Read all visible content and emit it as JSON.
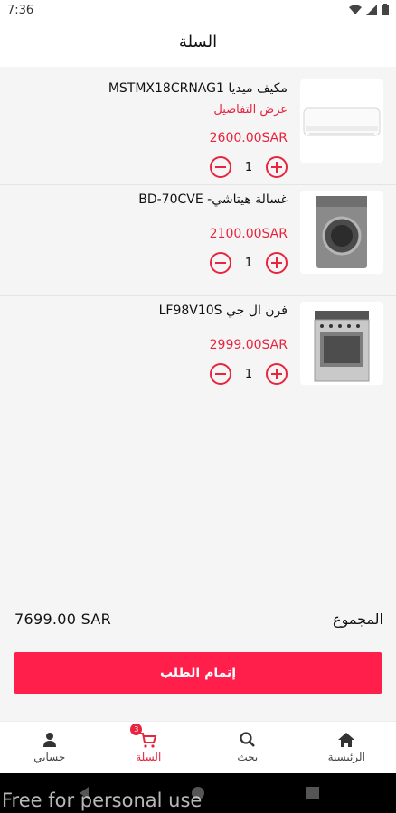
{
  "status": {
    "time": "7:36",
    "icons": [
      "wifi-icon",
      "cellular-signal-icon",
      "battery-icon"
    ]
  },
  "header": {
    "title": "السلة"
  },
  "cart": {
    "items": [
      {
        "name": "مكيف ميديا MSTMX18CRNAG1",
        "details_link": "عرض التفاصيل",
        "price": "2600.00SAR",
        "quantity": "1",
        "image": "air-conditioner-image"
      },
      {
        "name": "غسالة هيتاشي- BD-70CVE",
        "details_link": "",
        "price": "2100.00SAR",
        "quantity": "1",
        "image": "washing-machine-image"
      },
      {
        "name": "فرن ال جي LF98V10S",
        "details_link": "",
        "price": "2999.00SAR",
        "quantity": "1",
        "image": "gas-oven-image"
      }
    ]
  },
  "summary": {
    "total_label": "المجموع",
    "total_value": "7699.00 SAR"
  },
  "checkout": {
    "label": "إتمام الطلب"
  },
  "bottom_nav": {
    "items": [
      {
        "label": "حسابي",
        "icon": "person-icon"
      },
      {
        "label": "السلة",
        "icon": "cart-icon",
        "badge": "3",
        "active": true
      },
      {
        "label": "بحث",
        "icon": "search-icon"
      },
      {
        "label": "الرئيسية",
        "icon": "home-icon"
      }
    ]
  },
  "watermark": "Free for personal use",
  "colors": {
    "accent": "#e8243f",
    "button": "#ff1f4a",
    "background": "#f5f5f5"
  }
}
